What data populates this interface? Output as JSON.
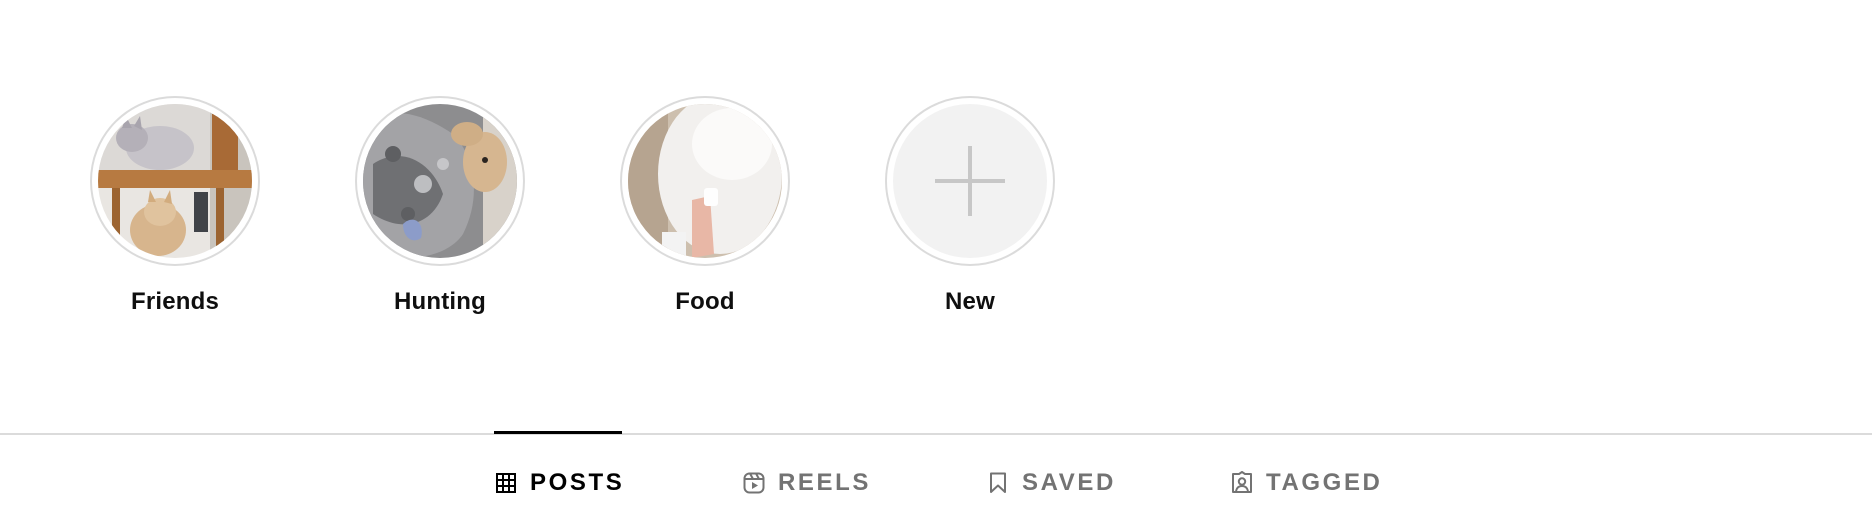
{
  "highlights": [
    {
      "label": "Friends",
      "image": "cats-on-wooden-shelf-photo"
    },
    {
      "label": "Hunting",
      "image": "cat-on-patterned-blanket-photo"
    },
    {
      "label": "Food",
      "image": "white-cat-with-hand-photo"
    },
    {
      "label": "New",
      "image": "plus-icon"
    }
  ],
  "tabs": [
    {
      "label": "POSTS",
      "icon": "grid-icon",
      "active": true
    },
    {
      "label": "REELS",
      "icon": "reels-icon",
      "active": false
    },
    {
      "label": "SAVED",
      "icon": "bookmark-icon",
      "active": false
    },
    {
      "label": "TAGGED",
      "icon": "tagged-icon",
      "active": false
    }
  ],
  "colors": {
    "ring": "#dbdbdb",
    "active_tab": "#000000",
    "inactive_tab": "#737373",
    "new_bg": "#f2f2f2",
    "plus": "#c7c7c7"
  }
}
